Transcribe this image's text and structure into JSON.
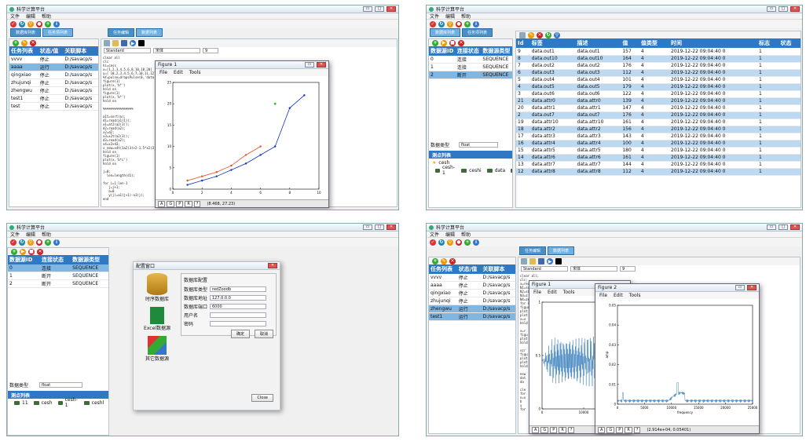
{
  "app": {
    "title": "科学计算平台",
    "menu": [
      "文件",
      "编辑",
      "帮助"
    ],
    "tabs_left": [
      "数据库列表",
      "任务项列表"
    ],
    "tabs_right": [
      "任务编辑",
      "数据列表"
    ],
    "editor_mode": "Standard",
    "editor_font": "宋体",
    "editor_size": "9",
    "win_min": "▭",
    "win_max": "▢",
    "win_close": "✕"
  },
  "tasks": {
    "headers": [
      "任务列表",
      "状态/值",
      "关联脚本"
    ],
    "rows": [
      [
        "vvvv",
        "停止",
        "D:/savacp/s"
      ],
      [
        "aaaa",
        "运行",
        "D:/savacp/s"
      ],
      [
        "qingxiao",
        "停止",
        "D:/savacp/s"
      ],
      [
        "zhujunqi",
        "停止",
        "D:/savacp/s"
      ],
      [
        "zhengwu",
        "停止",
        "D:/savacp/s"
      ],
      [
        "test1",
        "停止",
        "D:/savacp/s"
      ],
      [
        "test",
        "停止",
        "D:/savacp/s"
      ]
    ],
    "rows_q4": [
      [
        "vvvv",
        "停止",
        "D:/savacp/s"
      ],
      [
        "aaaa",
        "停止",
        "D:/savacp/s"
      ],
      [
        "qingxiao",
        "停止",
        "D:/savacp/s"
      ],
      [
        "zhujunqi",
        "停止",
        "D:/savacp/s"
      ],
      [
        "zhengwu",
        "运行",
        "D:/savacp/s"
      ],
      [
        "test1",
        "运行",
        "D:/savacp/s"
      ]
    ]
  },
  "code1": "clear all\nclc\nhi=cess\nx=[1,2,3,4,5,6,8,10,18,20]\ny=[ 10,2,3,4,5,6,7,10,11,12]\n%Y=pulse=dropsPulse(0,'data'\nfigure(1)\nplot(x,'b*')\nhold on\nfigure(1)\nplot(x,'b*')\nhold on\n\n%%%%%%%%%%%%%%%%\n\na1t=sort(a);\nd1=read(a1(1));\nx1=at2(a2(3));\nd2=read(a2);\nx2=d2;\nx3=x2t(a2(3));\nd3=read(a2);\nx4=x3+d3;\nx_new=x4t(1a2(3)+2-1.5*x2(3)\nhold on\nfigure(1)\nplot(x,'b*c')\nhold on\n\nj=0;\n  len=length(d1);\n\nfor i=1:len-1\n   j=j+1;\n   a=0\n   y(j)=a1(j+1)-a1(j);\nend",
  "code2": "clear all;\nclc;\nx=read(\nN1=sort\nN2=size\nN3=z\nN4=zeros\nfor i=\nfigur\nplot\nplot\nx=x\nhold\n\nx=r\nfigu\nplot\nhold\n\nxzr\nfigu\nplot\nplot\nhold\n\nnew\ndat\nda\n\ncle\nfor\nn=x\nb\ny\nfor",
  "fig1": {
    "title": "Figure 1",
    "menu": [
      "File",
      "Edit",
      "Tools"
    ],
    "coords": "(8.468, 27.23)",
    "buttons": [
      "A",
      "G",
      "P",
      "R",
      "?"
    ],
    "chart_data": {
      "type": "line",
      "xlim": [
        0,
        10
      ],
      "ylim": [
        0,
        25
      ],
      "xticks": [
        "0",
        "2",
        "4",
        "6",
        "8",
        "10"
      ],
      "yticks": [
        "0",
        "5",
        "10",
        "15",
        "20",
        "25"
      ],
      "series": [
        {
          "color": "#1030c8",
          "x": [
            1,
            2,
            3,
            4,
            5,
            6,
            7,
            8,
            9
          ],
          "y": [
            1,
            2,
            3,
            4.5,
            6,
            8,
            10,
            19,
            22
          ]
        },
        {
          "color": "#e05020",
          "x": [
            1,
            2,
            3,
            4,
            5,
            6
          ],
          "y": [
            2,
            3,
            4,
            5.5,
            8,
            10
          ]
        }
      ],
      "points": [
        {
          "color": "#30c030",
          "x": 7,
          "y": 20
        }
      ]
    }
  },
  "fig2": {
    "title": "Figure 2",
    "menu": [
      "File",
      "Edit",
      "Tools"
    ],
    "coords": "(2.914e+04, 0.05401)",
    "buttons": [
      "A",
      "G",
      "P",
      "R",
      "?"
    ],
    "xlabel": "frequency",
    "ylabel": "amp",
    "chart_data": {
      "type": "line",
      "xlim": [
        0,
        25000
      ],
      "ylim": [
        0,
        0.05
      ],
      "xticks": [
        "0",
        "5000",
        "10000",
        "15000",
        "20000",
        "25000"
      ],
      "yticks": [
        "0",
        "0.01",
        "0.02",
        "0.03",
        "0.04",
        "0.05"
      ]
    }
  },
  "figBehind": {
    "xticks": [
      "0",
      "10000",
      "20000"
    ],
    "yticks": [
      "0",
      "0.5",
      "1"
    ]
  },
  "sources": {
    "headers": [
      "数据源ID",
      "连接状态",
      "数据源类型"
    ],
    "rows": [
      [
        "0",
        "连接",
        "SEQUENCE"
      ],
      [
        "1",
        "连接",
        "SEQUENCE"
      ],
      [
        "2",
        "断开",
        "SEQUENCE"
      ]
    ],
    "rows_q3": [
      [
        "0",
        "连接",
        "SEQUENCE"
      ],
      [
        "1",
        "断开",
        "SEQUENCE"
      ],
      [
        "2",
        "断开",
        "SEQUENCE"
      ]
    ],
    "type_label": "数据类型",
    "type_value": "float",
    "tree_title": "测点列表",
    "tree_root": "cesh",
    "tree": [
      "cesh-1",
      "ceshi",
      "data",
      "mit",
      "test"
    ],
    "tree_q3": [
      "11",
      "cesh",
      "cesh-1",
      "ceshl",
      "data",
      "mit",
      "test"
    ]
  },
  "points": {
    "headers": [
      "Id",
      "标签",
      "描述",
      "值",
      "值类型",
      "时间",
      "标志",
      "状态"
    ],
    "rows": [
      [
        "9",
        "data.out1",
        "data.out1",
        "157",
        "4",
        "2019-12-22 09:04:40 0",
        "1",
        ""
      ],
      [
        "8",
        "data.out10",
        "data.out10",
        "164",
        "4",
        "2019-12-22 09:04:40 0",
        "1",
        ""
      ],
      [
        "7",
        "data.out2",
        "data.out2",
        "176",
        "4",
        "2019-12-22 09:04:40 0",
        "1",
        ""
      ],
      [
        "6",
        "data.out3",
        "data.out3",
        "112",
        "4",
        "2019-12-22 09:04:40 0",
        "1",
        ""
      ],
      [
        "5",
        "data.out4",
        "data.out4",
        "101",
        "4",
        "2019-12-22 09:04:40 0",
        "1",
        ""
      ],
      [
        "4",
        "data.out5",
        "data.out5",
        "179",
        "4",
        "2019-12-22 09:04:40 0",
        "1",
        ""
      ],
      [
        "3",
        "data.out6",
        "data.out6",
        "122",
        "4",
        "2019-12-22 09:04:40 0",
        "1",
        ""
      ],
      [
        "21",
        "data.attr0",
        "data.attr0",
        "139",
        "4",
        "2019-12-22 09:04:40 0",
        "1",
        ""
      ],
      [
        "20",
        "data.attr1",
        "data.attr1",
        "147",
        "4",
        "2019-12-22 09:04:40 0",
        "1",
        ""
      ],
      [
        "2",
        "data.out7",
        "data.out7",
        "176",
        "4",
        "2019-12-22 09:04:40 0",
        "1",
        ""
      ],
      [
        "19",
        "data.attr10",
        "data.attr10",
        "161",
        "4",
        "2019-12-22 09:04:40 0",
        "1",
        ""
      ],
      [
        "18",
        "data.attr2",
        "data.attr2",
        "156",
        "4",
        "2019-12-22 09:04:40 0",
        "1",
        ""
      ],
      [
        "17",
        "data.attr3",
        "data.attr3",
        "143",
        "4",
        "2019-12-22 09:04:40 0",
        "1",
        ""
      ],
      [
        "16",
        "data.attr4",
        "data.attr4",
        "100",
        "4",
        "2019-12-22 09:04:40 0",
        "1",
        ""
      ],
      [
        "15",
        "data.attr5",
        "data.attr5",
        "180",
        "4",
        "2019-12-22 09:04:40 0",
        "1",
        ""
      ],
      [
        "14",
        "data.attr6",
        "data.attr6",
        "161",
        "4",
        "2019-12-22 09:04:40 0",
        "1",
        ""
      ],
      [
        "13",
        "data.attr7",
        "data.attr7",
        "144",
        "4",
        "2019-12-22 09:04:40 0",
        "1",
        ""
      ],
      [
        "12",
        "data.attr8",
        "data.attr8",
        "112",
        "4",
        "2019-12-22 09:04:40 0",
        "1",
        ""
      ]
    ]
  },
  "config": {
    "title": "配置窗口",
    "section": "数据库配置",
    "fields": [
      {
        "label": "数据库类型",
        "value": "redZoodb"
      },
      {
        "label": "数据库地址",
        "value": "127.0.0.0"
      },
      {
        "label": "数据库端口",
        "value": "6000"
      },
      {
        "label": "用户名",
        "value": ""
      },
      {
        "label": "密码",
        "value": ""
      }
    ],
    "ok": "确定",
    "cancel": "取消",
    "close": "Close",
    "icons": [
      "时序数据库",
      "Excel数据源",
      "其它数据源"
    ]
  }
}
